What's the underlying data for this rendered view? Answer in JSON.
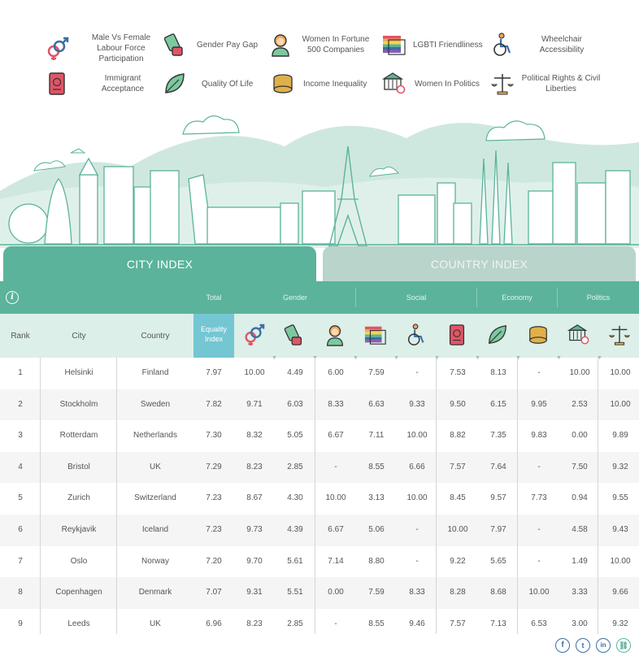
{
  "legend": [
    {
      "key": "labour",
      "label_lines": [
        "Male Vs Female",
        "Labour Force",
        "Participation"
      ],
      "icon": "gender-symbols-icon"
    },
    {
      "key": "pay",
      "label_lines": [
        "Gender Pay Gap"
      ],
      "icon": "money-hand-icon"
    },
    {
      "key": "fortune",
      "label_lines": [
        "Women In Fortune",
        "500 Companies"
      ],
      "icon": "businesswoman-icon"
    },
    {
      "key": "lgbti",
      "label_lines": [
        "LGBTI Friendliness"
      ],
      "icon": "rainbow-flag-icon"
    },
    {
      "key": "wheelchair",
      "label_lines": [
        "Wheelchair",
        "Accessibility"
      ],
      "icon": "wheelchair-icon"
    },
    {
      "key": "immigrant",
      "label_lines": [
        "Immigrant",
        "Acceptance"
      ],
      "icon": "passport-icon"
    },
    {
      "key": "quality",
      "label_lines": [
        "Quality Of Life"
      ],
      "icon": "leaf-icon"
    },
    {
      "key": "income",
      "label_lines": [
        "Income Inequality"
      ],
      "icon": "coins-icon"
    },
    {
      "key": "politics",
      "label_lines": [
        "Women In Politics"
      ],
      "icon": "parliament-icon"
    },
    {
      "key": "rights",
      "label_lines": [
        "Political Rights & Civil",
        "Liberties"
      ],
      "icon": "scales-icon"
    }
  ],
  "tabs": {
    "city": "CITY INDEX",
    "country": "COUNTRY INDEX"
  },
  "categories": {
    "total": "Total",
    "gender": "Gender",
    "social": "Social",
    "economy": "Economy",
    "politics": "Politics"
  },
  "headers": {
    "rank": "Rank",
    "city": "City",
    "country": "Country",
    "equality_line1": "Equality",
    "equality_line2": "Index"
  },
  "rows": [
    {
      "rank": "1",
      "city": "Helsinki",
      "country": "Finland",
      "values": [
        "7.97",
        "10.00",
        "4.49",
        "6.00",
        "7.59",
        "-",
        "7.53",
        "8.13",
        "-",
        "10.00",
        "10.00"
      ]
    },
    {
      "rank": "2",
      "city": "Stockholm",
      "country": "Sweden",
      "values": [
        "7.82",
        "9.71",
        "6.03",
        "8.33",
        "6.63",
        "9.33",
        "9.50",
        "6.15",
        "9.95",
        "2.53",
        "10.00"
      ]
    },
    {
      "rank": "3",
      "city": "Rotterdam",
      "country": "Netherlands",
      "values": [
        "7.30",
        "8.32",
        "5.05",
        "6.67",
        "7.11",
        "10.00",
        "8.82",
        "7.35",
        "9.83",
        "0.00",
        "9.89"
      ]
    },
    {
      "rank": "4",
      "city": "Bristol",
      "country": "UK",
      "values": [
        "7.29",
        "8.23",
        "2.85",
        "-",
        "8.55",
        "6.66",
        "7.57",
        "7.64",
        "-",
        "7.50",
        "9.32"
      ]
    },
    {
      "rank": "5",
      "city": "Zurich",
      "country": "Switzerland",
      "values": [
        "7.23",
        "8.67",
        "4.30",
        "10.00",
        "3.13",
        "10.00",
        "8.45",
        "9.57",
        "7.73",
        "0.94",
        "9.55"
      ]
    },
    {
      "rank": "6",
      "city": "Reykjavik",
      "country": "Iceland",
      "values": [
        "7.23",
        "9.73",
        "4.39",
        "6.67",
        "5.06",
        "-",
        "10.00",
        "7.97",
        "-",
        "4.58",
        "9.43"
      ]
    },
    {
      "rank": "7",
      "city": "Oslo",
      "country": "Norway",
      "values": [
        "7.20",
        "9.70",
        "5.61",
        "7.14",
        "8.80",
        "-",
        "9.22",
        "5.65",
        "-",
        "1.49",
        "10.00"
      ]
    },
    {
      "rank": "8",
      "city": "Copenhagen",
      "country": "Denmark",
      "values": [
        "7.07",
        "9.31",
        "5.51",
        "0.00",
        "7.59",
        "8.33",
        "8.28",
        "8.68",
        "10.00",
        "3.33",
        "9.66"
      ]
    },
    {
      "rank": "9",
      "city": "Leeds",
      "country": "UK",
      "values": [
        "6.96",
        "8.23",
        "2.85",
        "-",
        "8.55",
        "9.46",
        "7.57",
        "7.13",
        "6.53",
        "3.00",
        "9.32"
      ]
    }
  ],
  "share": {
    "facebook": "f",
    "twitter": "t",
    "linkedin": "in",
    "link": "⛓"
  },
  "colors": {
    "primary": "#5bb39c",
    "light": "#dcefe8",
    "accent": "#74c6d3",
    "tab_inactive": "#b9d4cb"
  }
}
